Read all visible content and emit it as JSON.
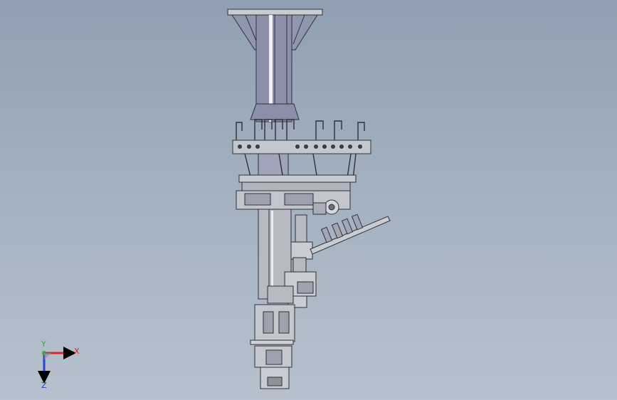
{
  "viewport": {
    "background_top": "#90a0b2",
    "background_bottom": "#b7c1cd"
  },
  "model": {
    "body_color": "#8a8ea6",
    "frame_color": "#b9bcc4",
    "edge_color": "#2f3136"
  },
  "triad": {
    "x_label": "X",
    "y_label": "Y",
    "z_label": "Z",
    "x_color": "#d6262b",
    "y_color": "#2faa3a",
    "z_color": "#2a43c9"
  }
}
